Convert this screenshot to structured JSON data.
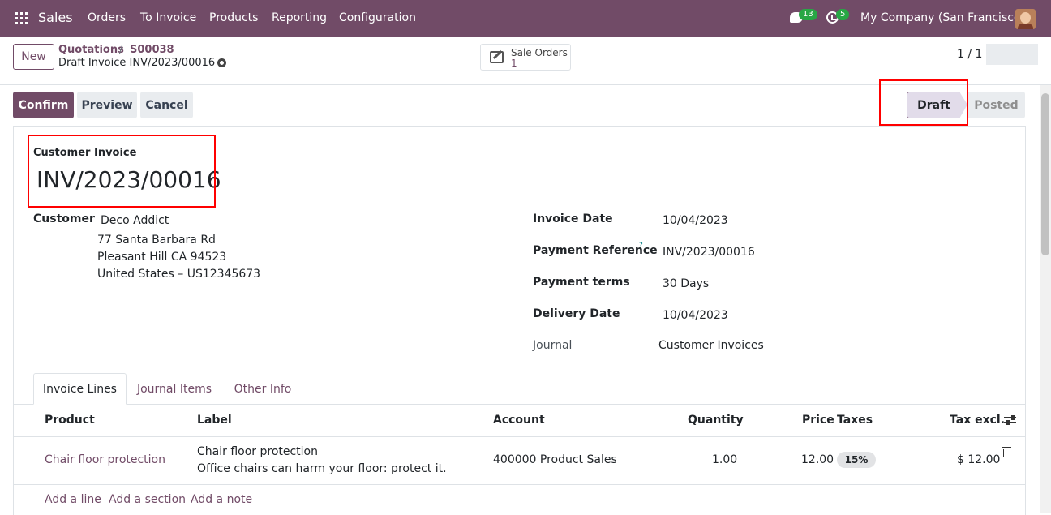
{
  "topbar": {
    "app_name": "Sales",
    "menu": [
      "Orders",
      "To Invoice",
      "Products",
      "Reporting",
      "Configuration"
    ],
    "messages_count": "13",
    "activities_count": "5",
    "company": "My Company (San Francisco)"
  },
  "control": {
    "new_label": "New",
    "breadcrumb_parent": "Quotations",
    "breadcrumb_sep": "/",
    "breadcrumb_order": "S00038",
    "breadcrumb_current": "Draft Invoice INV/2023/00016",
    "smart_button_label": "Sale Orders",
    "smart_button_value": "1",
    "pager": "1 / 1"
  },
  "actions": {
    "confirm": "Confirm",
    "preview": "Preview",
    "cancel": "Cancel"
  },
  "status": {
    "stages": [
      "Draft",
      "Posted"
    ],
    "current": "Draft"
  },
  "form": {
    "doc_type": "Customer Invoice",
    "doc_name": "INV/2023/00016",
    "customer_label": "Customer",
    "customer_name": "Deco Addict",
    "customer_address": [
      "77 Santa Barbara Rd",
      "Pleasant Hill CA 94523",
      "United States – US12345673"
    ],
    "invoice_date_label": "Invoice Date",
    "invoice_date": "10/04/2023",
    "payment_reference_label": "Payment Reference",
    "payment_reference_help": "?",
    "payment_reference": "INV/2023/00016",
    "payment_terms_label": "Payment terms",
    "payment_terms": "30 Days",
    "delivery_date_label": "Delivery Date",
    "delivery_date": "10/04/2023",
    "journal_label": "Journal",
    "journal": "Customer Invoices"
  },
  "tabs": [
    "Invoice Lines",
    "Journal Items",
    "Other Info"
  ],
  "table": {
    "headers": [
      "Product",
      "Label",
      "Account",
      "Quantity",
      "Price",
      "Taxes",
      "Tax excl."
    ],
    "rows": [
      {
        "product": "Chair floor protection",
        "label_line1": "Chair floor protection",
        "label_line2": "Office chairs can harm your floor: protect it.",
        "account": "400000 Product Sales",
        "quantity": "1.00",
        "price": "12.00",
        "taxes": "15%",
        "tax_excl": "$ 12.00"
      }
    ],
    "add_line": "Add a line",
    "add_section": "Add a section",
    "add_note": "Add a note"
  },
  "colors": {
    "brand": "#714b67",
    "highlight": "#ff0000"
  }
}
